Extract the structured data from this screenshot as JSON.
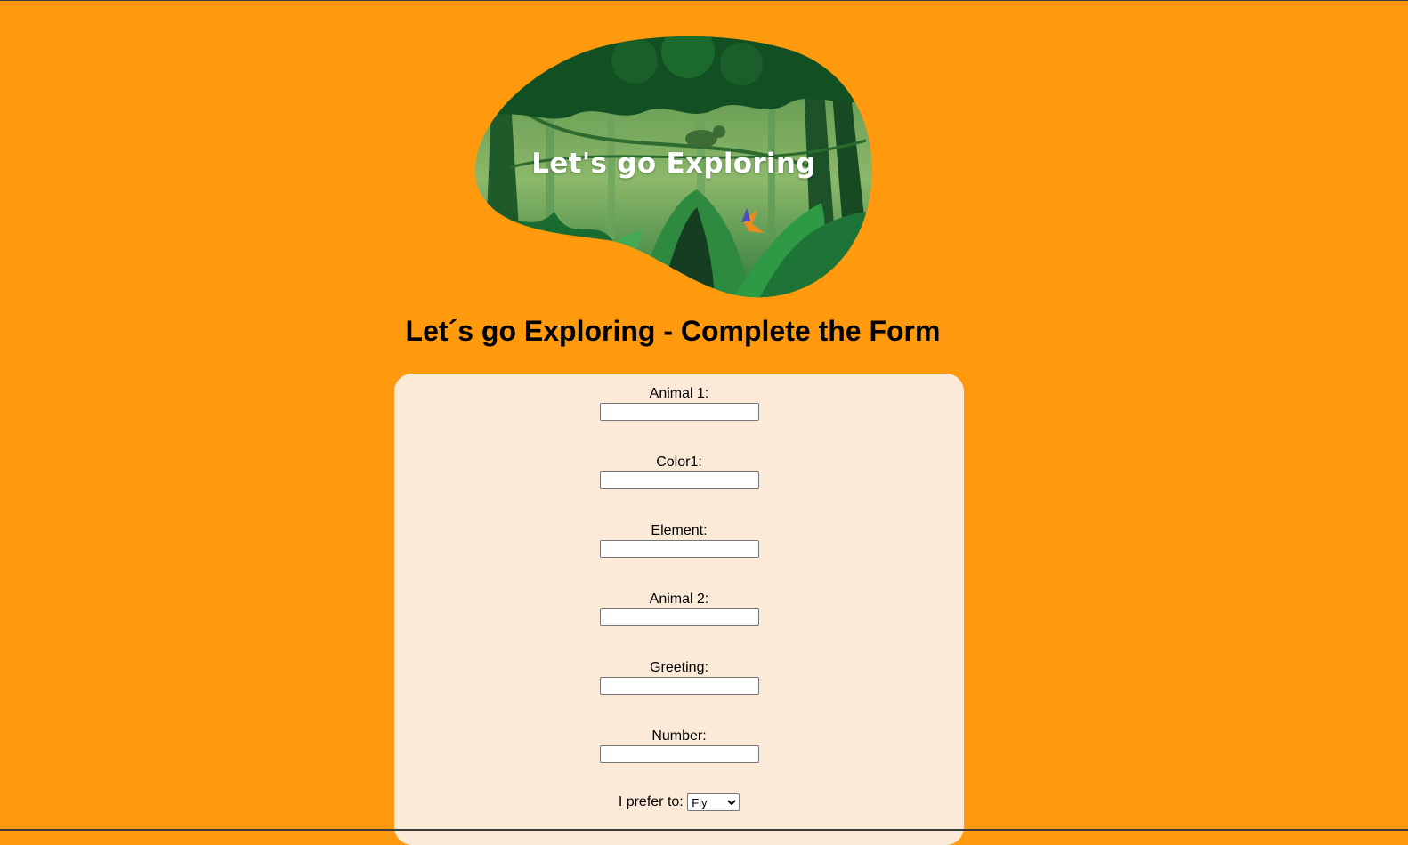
{
  "hero": {
    "banner_text": "Let's go Exploring"
  },
  "page": {
    "title": "Let´s go Exploring - Complete the Form"
  },
  "form": {
    "fields": [
      {
        "label": "Animal 1:",
        "value": ""
      },
      {
        "label": "Color1:",
        "value": ""
      },
      {
        "label": "Element:",
        "value": ""
      },
      {
        "label": "Animal 2:",
        "value": ""
      },
      {
        "label": "Greeting:",
        "value": ""
      },
      {
        "label": "Number:",
        "value": ""
      }
    ],
    "preference": {
      "label": "I prefer to:",
      "selected": "Fly"
    }
  },
  "colors": {
    "background": "#ff9a0e",
    "card": "#faead7"
  }
}
